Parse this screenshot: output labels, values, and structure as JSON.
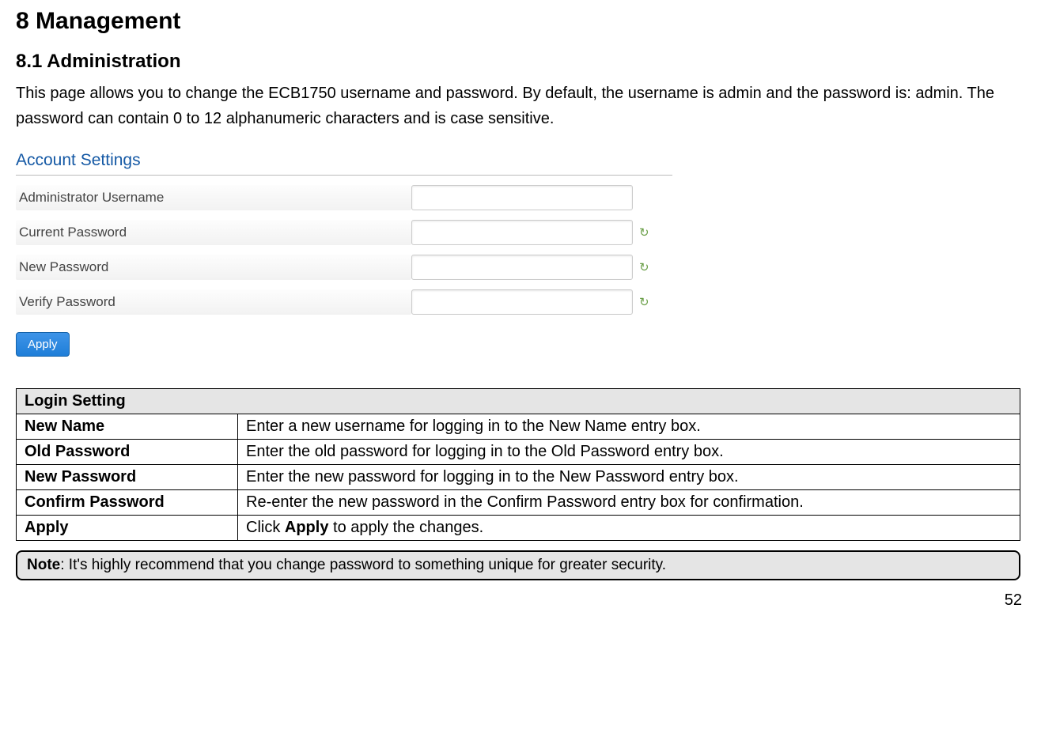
{
  "headings": {
    "h1": "8   Management",
    "h2": "8.1   Administration"
  },
  "intro": "This page allows you to change the ECB1750 username and password. By default, the username is admin and the password is: admin. The password can contain 0 to 12 alphanumeric characters and is case sensitive.",
  "form": {
    "title": "Account Settings",
    "rows": {
      "username": "Administrator Username",
      "current": "Current Password",
      "newp": "New Password",
      "verify": "Verify Password"
    },
    "apply": "Apply"
  },
  "table": {
    "header": "Login Setting",
    "rows": [
      {
        "label": "New Name",
        "desc": "Enter a new username for logging in to the New Name entry box."
      },
      {
        "label": "Old Password",
        "desc": "Enter the old password for logging in to the Old Password entry box."
      },
      {
        "label": "New Password",
        "desc": "Enter the new password for logging in to the New Password entry box."
      },
      {
        "label": "Confirm Password",
        "desc": "Re-enter the new password in the Confirm Password entry box for confirmation."
      },
      {
        "label": "Apply",
        "desc_prefix": "Click ",
        "desc_bold": "Apply",
        "desc_suffix": " to apply the changes."
      }
    ]
  },
  "note": {
    "label": "Note",
    "text": ": It's highly recommend that you change password to something unique for greater security."
  },
  "page_number": "52"
}
